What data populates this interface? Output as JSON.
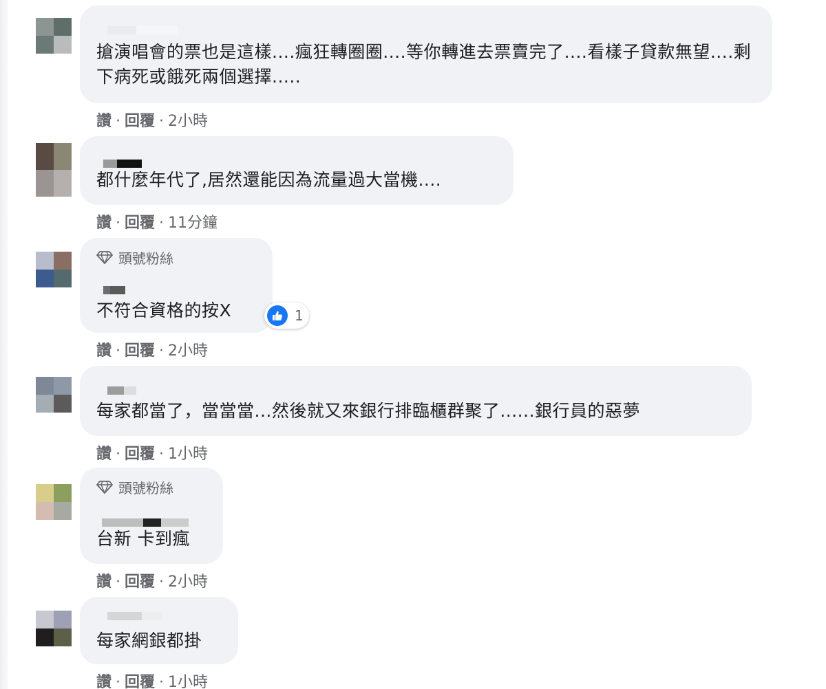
{
  "comments": [
    {
      "badge": "",
      "text": "搶演唱會的票也是這樣....瘋狂轉圈圈....等你轉進去票賣完了....看樣子貸款無望....剩下病死或餓死兩個選擇.....",
      "actions": {
        "like": "讚",
        "reply": "回覆",
        "time": "2小時"
      },
      "avatar_colors": [
        "#8d9592",
        "#5f6d6b",
        "#6b7a76",
        "#b8bdbb"
      ]
    },
    {
      "badge": "",
      "text": "都什麼年代了,居然還能因為流量過大當機....",
      "actions": {
        "like": "讚",
        "reply": "回覆",
        "time": "11分鐘"
      },
      "avatar_colors": [
        "#5a4a44",
        "#8a8775",
        "#9a9492",
        "#b5b0ad"
      ]
    },
    {
      "badge": "頭號粉絲",
      "text": "不符合資格的按X",
      "actions": {
        "like": "讚",
        "reply": "回覆",
        "time": "2小時"
      },
      "reaction_count": "1",
      "avatar_colors": [
        "#b9bccb",
        "#8a6e63",
        "#3d5b8e",
        "#546a6e"
      ]
    },
    {
      "badge": "",
      "text": "每家都當了，當當當...然後就又來銀行排臨櫃群聚了......銀行員的惡夢",
      "actions": {
        "like": "讚",
        "reply": "回覆",
        "time": "1小時"
      },
      "avatar_colors": [
        "#7e8896",
        "#8f98a6",
        "#a4adb3",
        "#5d5a5c"
      ]
    },
    {
      "badge": "頭號粉絲",
      "text": "台新 卡到瘋",
      "actions": {
        "like": "讚",
        "reply": "回覆",
        "time": "2小時"
      },
      "avatar_colors": [
        "#d8cd8a",
        "#8c9f5e",
        "#d4bcb1",
        "#a7a9a3"
      ]
    },
    {
      "badge": "",
      "text": "每家網銀都掛",
      "actions": {
        "like": "讚",
        "reply": "回覆",
        "time": "1小時"
      },
      "avatar_colors": [
        "#c8c8d0",
        "#9ea0b5",
        "#1f1d1e",
        "#5c6049"
      ]
    }
  ],
  "colors": {
    "bubble": "#f0f2f5",
    "meta_text": "#65676b",
    "like_blue": "#1877f2"
  },
  "icons": {
    "badge": "diamond-icon",
    "reaction": "thumbs-up-icon"
  }
}
